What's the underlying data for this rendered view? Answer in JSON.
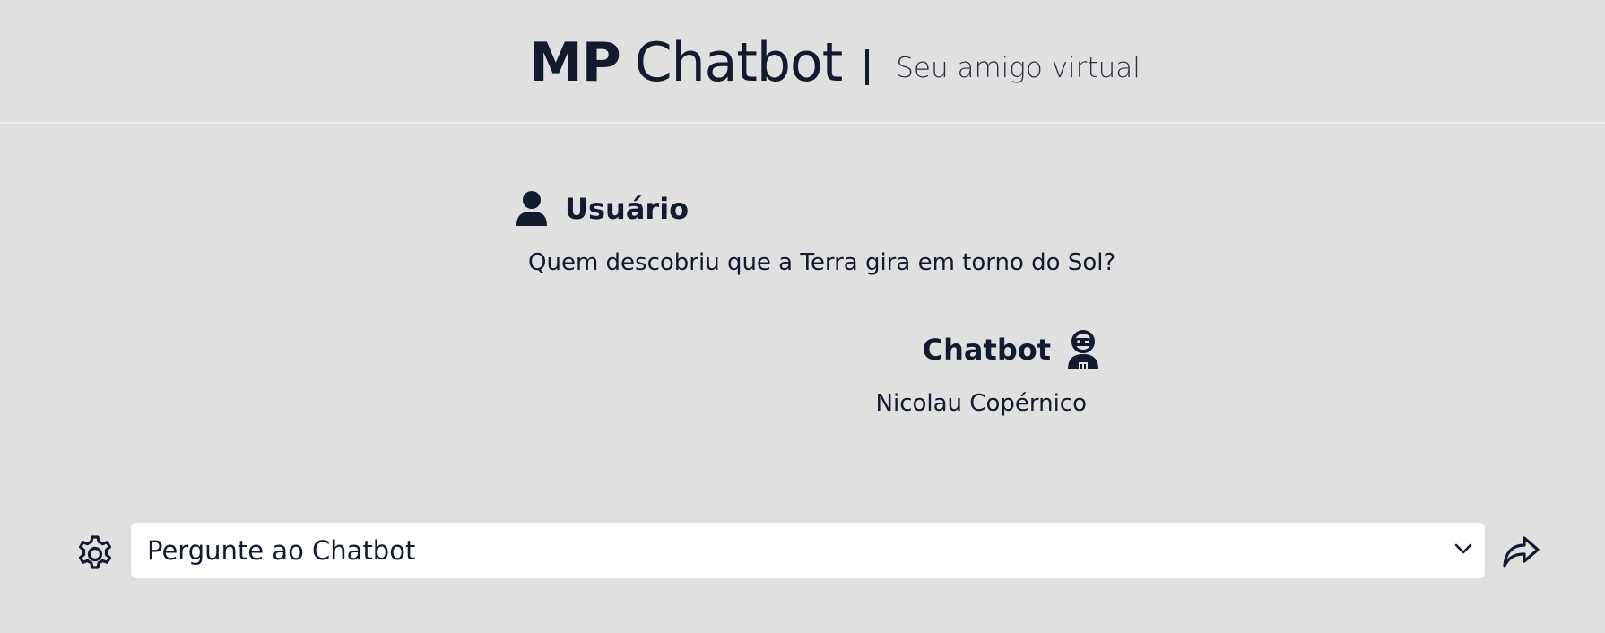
{
  "header": {
    "title_bold": "MP",
    "title_rest": "Chatbot",
    "separator": "|",
    "subtitle": "Seu amigo virtual"
  },
  "conversation": [
    {
      "role": "user",
      "author": "Usuário",
      "icon": "user-icon",
      "text": "Quem descobriu que a Terra gira em torno do Sol?"
    },
    {
      "role": "bot",
      "author": "Chatbot",
      "icon": "robot-icon",
      "text": "Nicolau Copérnico"
    }
  ],
  "composer": {
    "placeholder": "Pergunte ao Chatbot",
    "settings_icon": "gear-icon",
    "dropdown_icon": "chevron-down-icon",
    "send_icon": "share-arrow-icon"
  },
  "colors": {
    "background": "#e0e0e0",
    "text": "#141a2e",
    "input_background": "#ffffff"
  }
}
